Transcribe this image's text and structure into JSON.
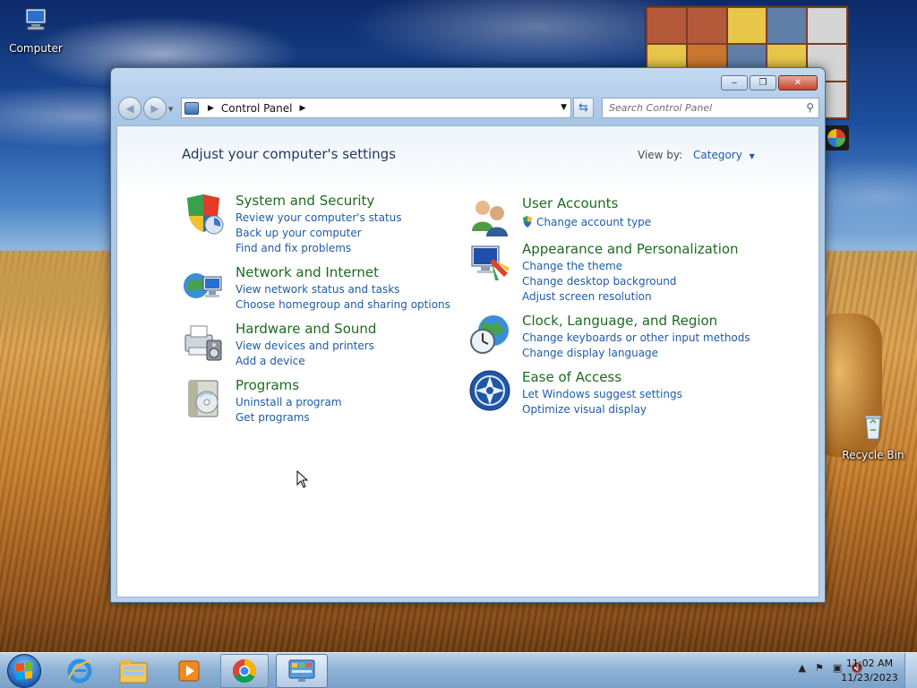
{
  "desktop": {
    "icons": [
      {
        "label": "Computer"
      },
      {
        "label": "Recycle Bin"
      }
    ]
  },
  "window": {
    "controls": {
      "minimize": "‒",
      "maximize": "❐",
      "close": "✕"
    },
    "address": {
      "crumbs": [
        "Control Panel"
      ],
      "search_placeholder": "Search Control Panel"
    },
    "heading": "Adjust your computer's settings",
    "view_by": {
      "label": "View by:",
      "value": "Category"
    },
    "categories_left": [
      {
        "title": "System and Security",
        "icon": "security-shield-icon",
        "links": [
          "Review your computer's status",
          "Back up your computer",
          "Find and fix problems"
        ]
      },
      {
        "title": "Network and Internet",
        "icon": "network-globe-icon",
        "links": [
          "View network status and tasks",
          "Choose homegroup and sharing options"
        ]
      },
      {
        "title": "Hardware and Sound",
        "icon": "printer-speaker-icon",
        "links": [
          "View devices and printers",
          "Add a device"
        ]
      },
      {
        "title": "Programs",
        "icon": "programs-disc-icon",
        "links": [
          "Uninstall a program",
          "Get programs"
        ]
      }
    ],
    "categories_right": [
      {
        "title": "User Accounts",
        "icon": "users-icon",
        "links": [
          "Change account type"
        ]
      },
      {
        "title": "Appearance and Personalization",
        "icon": "monitor-paint-icon",
        "links": [
          "Change the theme",
          "Change desktop background",
          "Adjust screen resolution"
        ]
      },
      {
        "title": "Clock, Language, and Region",
        "icon": "clock-globe-icon",
        "links": [
          "Change keyboards or other input methods",
          "Change display language"
        ]
      },
      {
        "title": "Ease of Access",
        "icon": "ease-of-access-icon",
        "links": [
          "Let Windows suggest settings",
          "Optimize visual display"
        ]
      }
    ]
  },
  "taskbar": {
    "apps": [
      {
        "name": "internet-explorer-icon"
      },
      {
        "name": "file-explorer-icon"
      },
      {
        "name": "media-player-icon"
      },
      {
        "name": "chrome-icon"
      },
      {
        "name": "control-panel-icon"
      }
    ],
    "clock": {
      "time": "11:02 AM",
      "date": "11/23/2023"
    }
  },
  "colors": {
    "category_title": "#1b6c1e",
    "link": "#1e5ca8",
    "heading": "#1e395b"
  }
}
